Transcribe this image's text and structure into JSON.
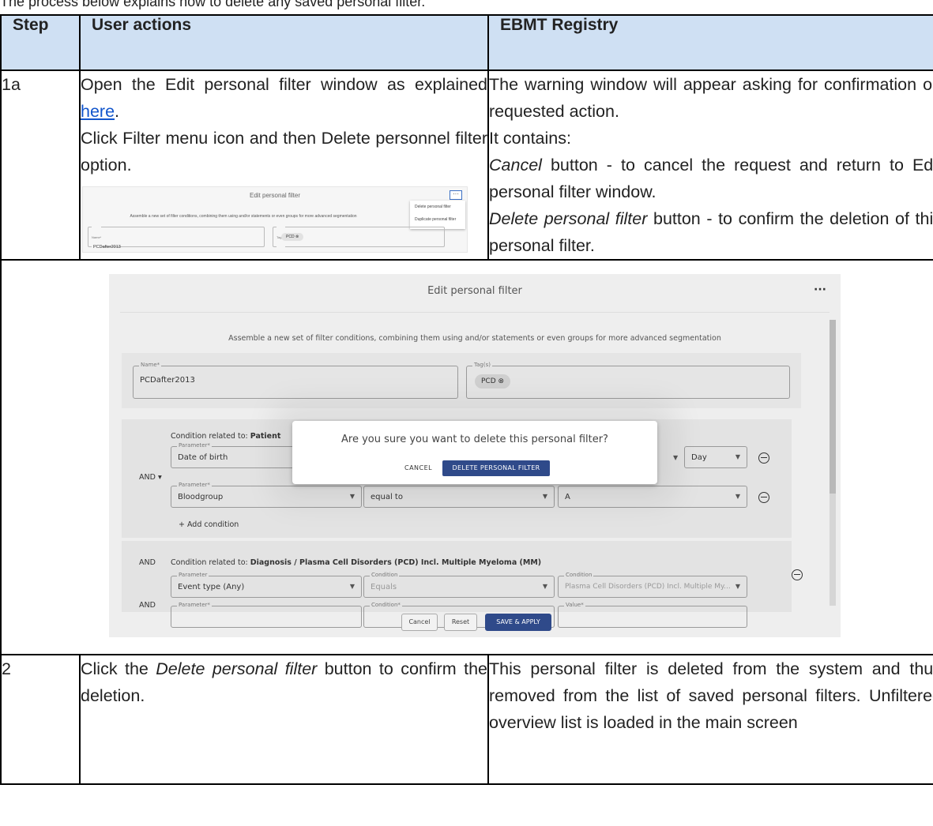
{
  "intro": "The process below explains how to delete any saved personal filter.",
  "table": {
    "headers": [
      "Step",
      "User actions",
      "EBMT Registry"
    ],
    "row1": {
      "step": "1a",
      "action_a": "Open the Edit personal filter window as explained ",
      "action_link": "here",
      "action_a_end": ".",
      "action_b": "Click Filter menu icon and then Delete personnel filter option.",
      "reg_1": "The warning window will appear asking for confirmation on requested action.",
      "reg_2": "It contains:",
      "reg_3_em": "Cancel",
      "reg_3": " button - to cancel the request and return to Edit personal filter window.",
      "reg_4_em": "Delete personal filter",
      "reg_4": " button - to confirm the deletion of this personal filter."
    },
    "row2": {
      "step": "2",
      "action_pre": "Click the ",
      "action_em": "Delete personal filter",
      "action_post": " button to confirm the deletion.",
      "reg": "This personal filter is deleted from the system and thus removed from the list of saved personal filters. Unfiltered overview list is loaded in the main screen"
    }
  },
  "mini_shot": {
    "title": "Edit personal filter",
    "menu_icon": "ellipsis-icon",
    "menu": [
      "Delete personal filter",
      "Duplicate personal filter"
    ],
    "desc": "Assemble a new set of filter conditions, combining them using and/or statements or even groups for more advanced segmentation",
    "name_label": "Name*",
    "name_value": "PCDafter2013",
    "tags_label": "Tag(s)",
    "tag": "PCD"
  },
  "shot": {
    "title": "Edit personal filter",
    "menu_icon": "ellipsis-icon",
    "desc": "Assemble a new set of filter conditions, combining them using and/or statements or even groups for more advanced segmentation",
    "name_label": "Name*",
    "name_value": "PCDafter2013",
    "tags_label": "Tag(s)",
    "tag": "PCD",
    "cond1_title_pre": "Condition related to: ",
    "cond1_title_bold": "Patient",
    "and_op": "AND",
    "param_label": "Parameter*",
    "p1": "Date of birth",
    "p2": "Bloodgroup",
    "p2_op": "equal to",
    "p2_val": "A",
    "day": "Day",
    "add_condition": "+ Add condition",
    "cond2_title_pre": "Condition related to: ",
    "cond2_title_bold": "Diagnosis / Plasma Cell Disorders (PCD) Incl. Multiple Myeloma (MM)",
    "parameter_label": "Parameter",
    "condition_label": "Condition",
    "c2_p1": "Event type (Any)",
    "c2_op": "Equals",
    "c2_val": "Plasma Cell Disorders (PCD) Incl. Multiple My...",
    "condition_req": "Condition*",
    "value_label": "Value*",
    "btn_cancel": "Cancel",
    "btn_reset": "Reset",
    "btn_save": "SAVE & APPLY",
    "dialog_q": "Are you sure you want to delete this personal filter?",
    "dialog_cancel": "CANCEL",
    "dialog_delete": "DELETE PERSONAL FILTER"
  }
}
